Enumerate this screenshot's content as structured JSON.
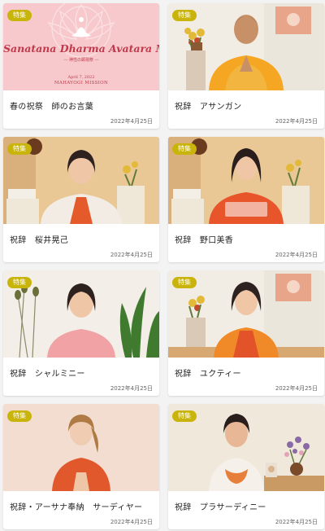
{
  "badge_label": "特集",
  "banner": {
    "title": "Sanatana Dharma Avatara Mela",
    "subtitle": "— 神性の顕現祭 —",
    "date": "April 7, 2022",
    "org": "MAHAYOGI MISSION"
  },
  "colors": {
    "badge": "#c9b40c",
    "banner_text": "#c0394b",
    "banner_bg": "#f7c9cc"
  },
  "cards": [
    {
      "title": "春の祝祭　師のお言葉",
      "date": "2022年4月25日"
    },
    {
      "title": "祝辞　アサンガン",
      "date": "2022年4月25日"
    },
    {
      "title": "祝辞　桜井晃己",
      "date": "2022年4月25日"
    },
    {
      "title": "祝辞　野口美香",
      "date": "2022年4月25日"
    },
    {
      "title": "祝辞　シャルミニー",
      "date": "2022年4月25日"
    },
    {
      "title": "祝辞　ユクティー",
      "date": "2022年4月25日"
    },
    {
      "title": "祝辞・アーサナ奉納　サーディヤー",
      "date": "2022年4月25日"
    },
    {
      "title": "祝辞　プラサーディニー",
      "date": "2022年4月25日"
    }
  ]
}
